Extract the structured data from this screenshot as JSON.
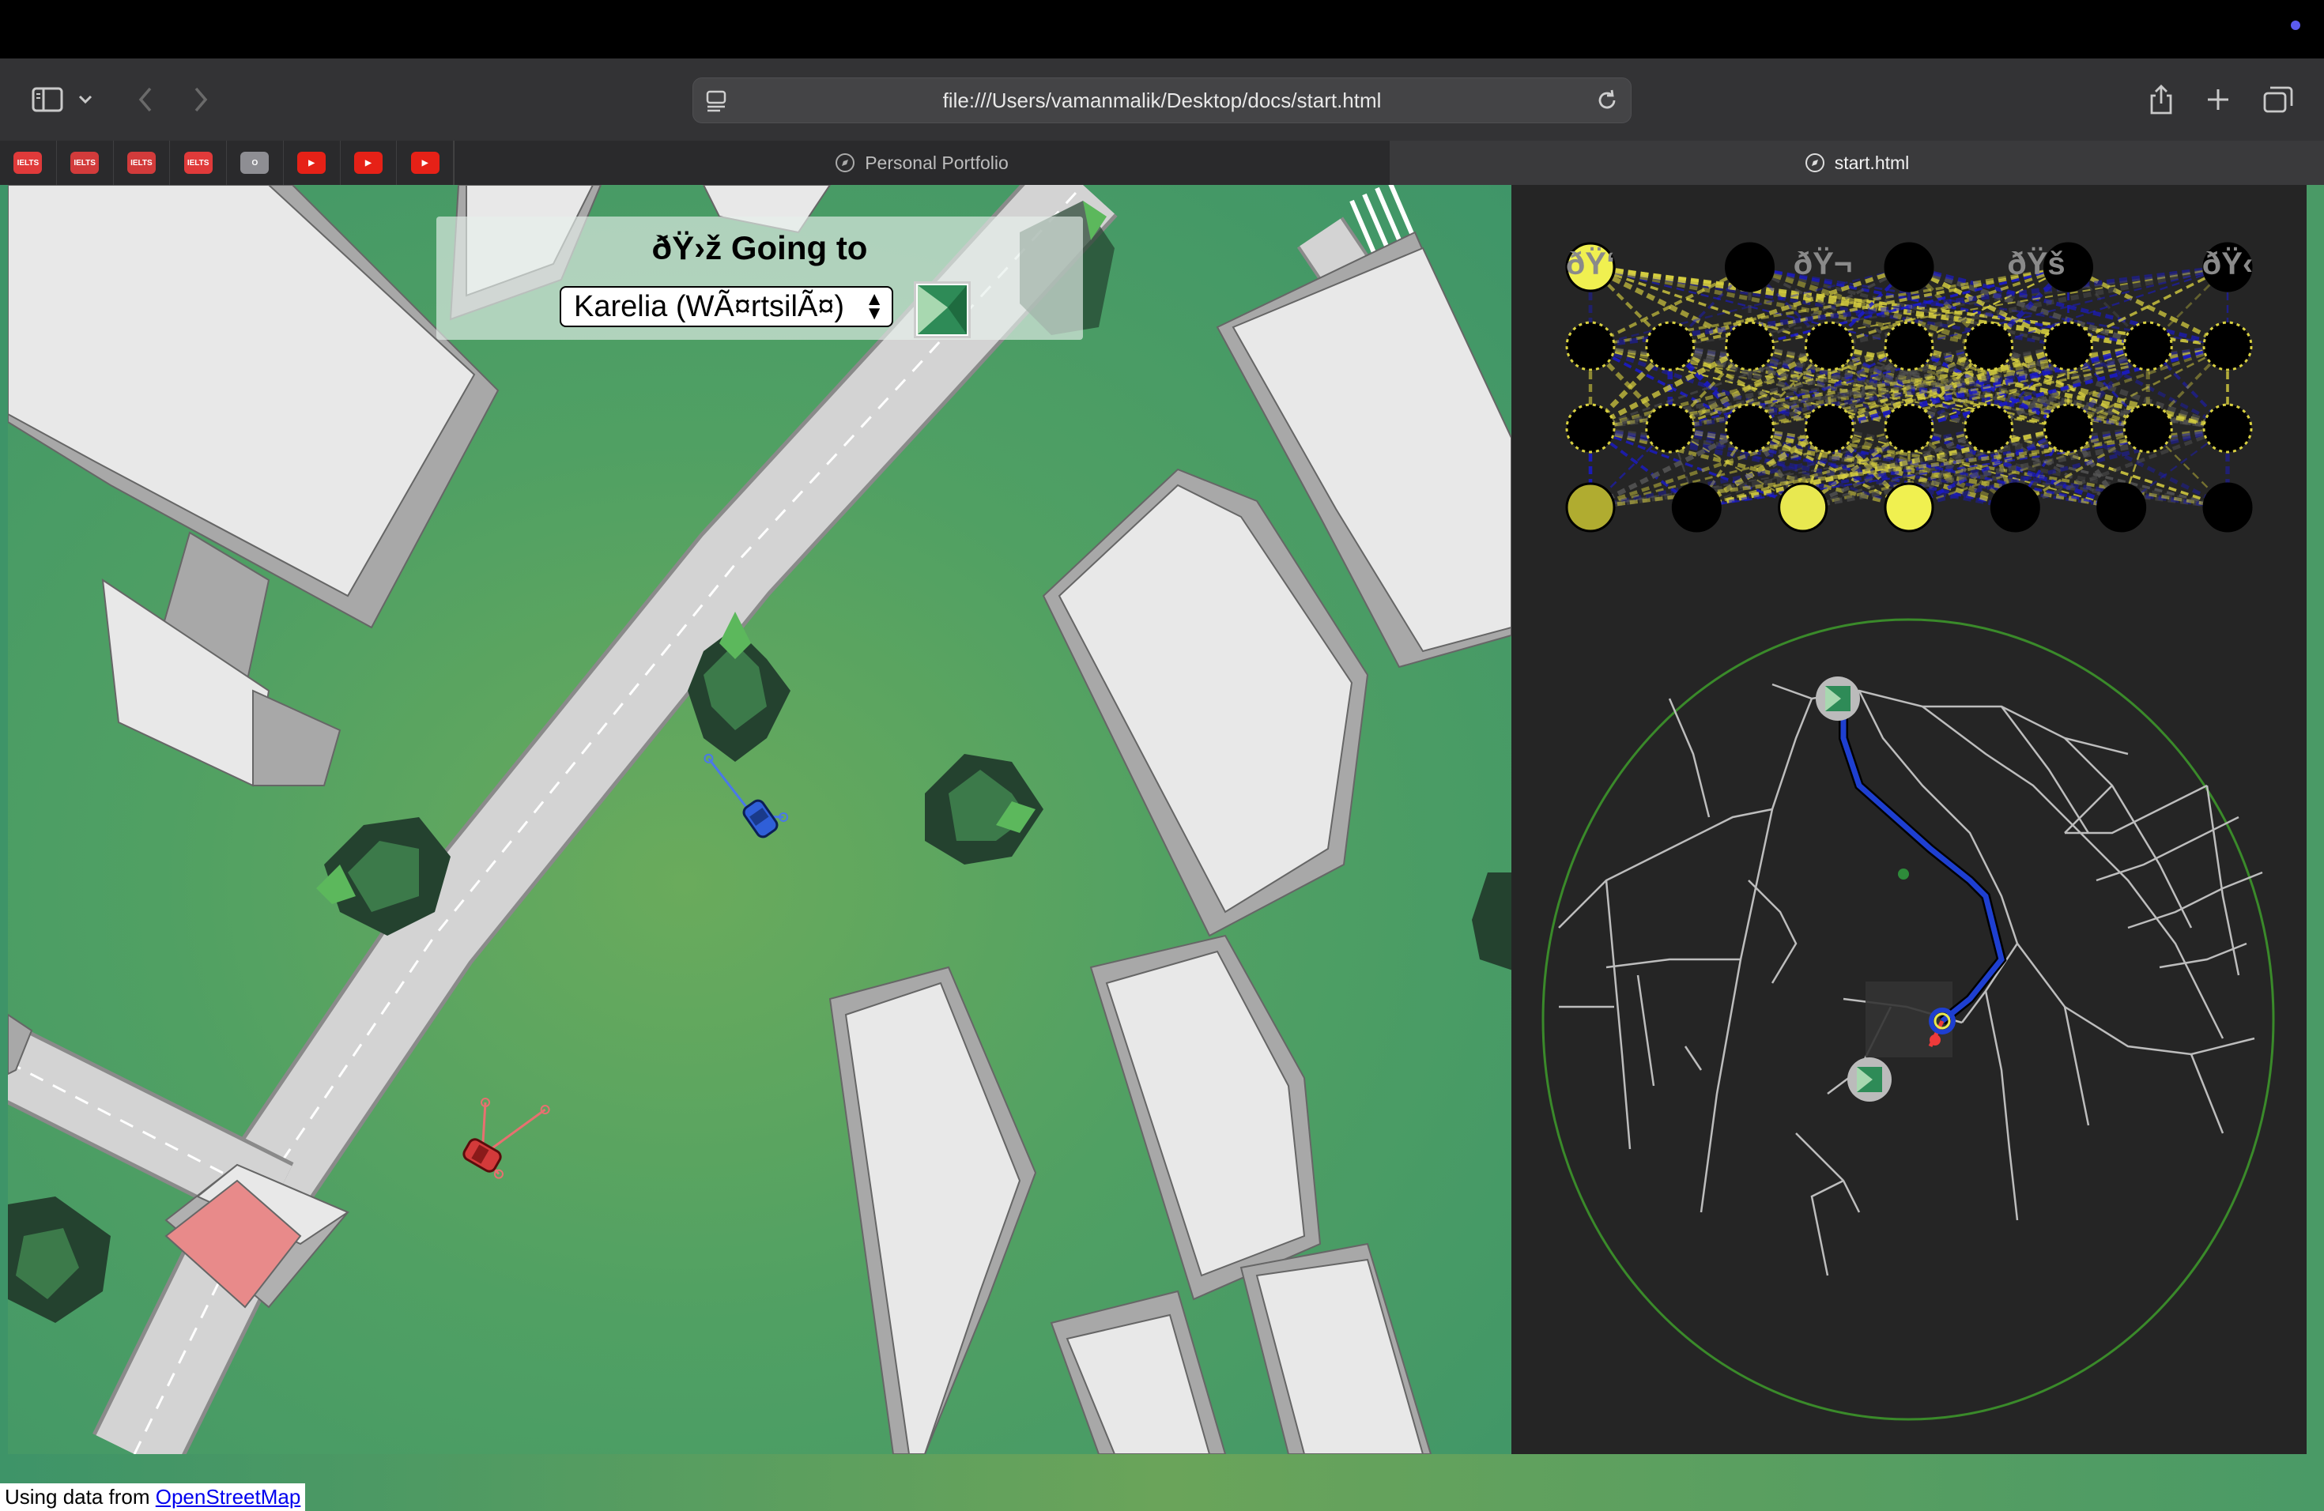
{
  "browser": {
    "url": "file:///Users/vamanmalik/Desktop/docs/start.html",
    "favorites": [
      {
        "label": "IELTS",
        "color": "#e03a3a"
      },
      {
        "label": "IELTS",
        "color": "#d23b3b"
      },
      {
        "label": "IELTS",
        "color": "#d23b3b"
      },
      {
        "label": "IELTS",
        "color": "#e03a3a"
      },
      {
        "label": "O",
        "color": "#8e8e93"
      },
      {
        "label": "▶",
        "color": "#e62117"
      },
      {
        "label": "▶",
        "color": "#e62117"
      },
      {
        "label": "▶",
        "color": "#e62117"
      }
    ],
    "tabs": [
      {
        "label": "Personal Portfolio",
        "active": false
      },
      {
        "label": "start.html",
        "active": true
      }
    ]
  },
  "overlay": {
    "title": "ðŸ›ž  Going to",
    "destination": "Karelia (WÃ¤rtsilÃ¤)"
  },
  "network": {
    "input_labels": [
      "ðŸ‘",
      "ðŸ¬",
      "ðŸš",
      "ðŸ‹"
    ],
    "layer_sizes": [
      5,
      9,
      9,
      7
    ],
    "output_activations": [
      0.65,
      0,
      0.9,
      1,
      0,
      0,
      0
    ]
  },
  "footer": {
    "prefix": "Using data from ",
    "link": "OpenStreetMap"
  },
  "colors": {
    "grass": "#50a063",
    "road": "#d3d3d3",
    "building_roof": "#e8e8e8",
    "building_side": "#a8a8a8",
    "player_car": "#2f5fd8",
    "other_car": "#d33a3a",
    "route": "#1e3fd0",
    "minimap_border": "#3a8a2a",
    "panel_bg": "#252525"
  }
}
